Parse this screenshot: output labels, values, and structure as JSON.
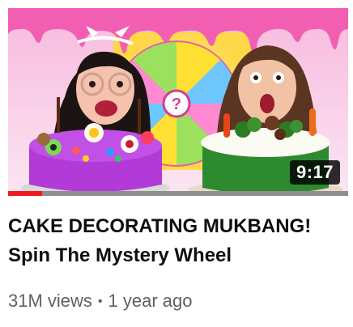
{
  "video": {
    "title": "CAKE DECORATING MUKBANG! Spin The Mystery Wheel",
    "duration": "9:17",
    "views": "31M views",
    "separator": "•",
    "age": "1 year ago",
    "progress_fraction": 0.1
  },
  "thumbnail": {
    "wheel_center_symbol": "?"
  },
  "colors": {
    "progress": "#ee1c1c",
    "progress_track": "#8f8f8f",
    "title": "#0f0f0f",
    "meta": "#606060"
  }
}
